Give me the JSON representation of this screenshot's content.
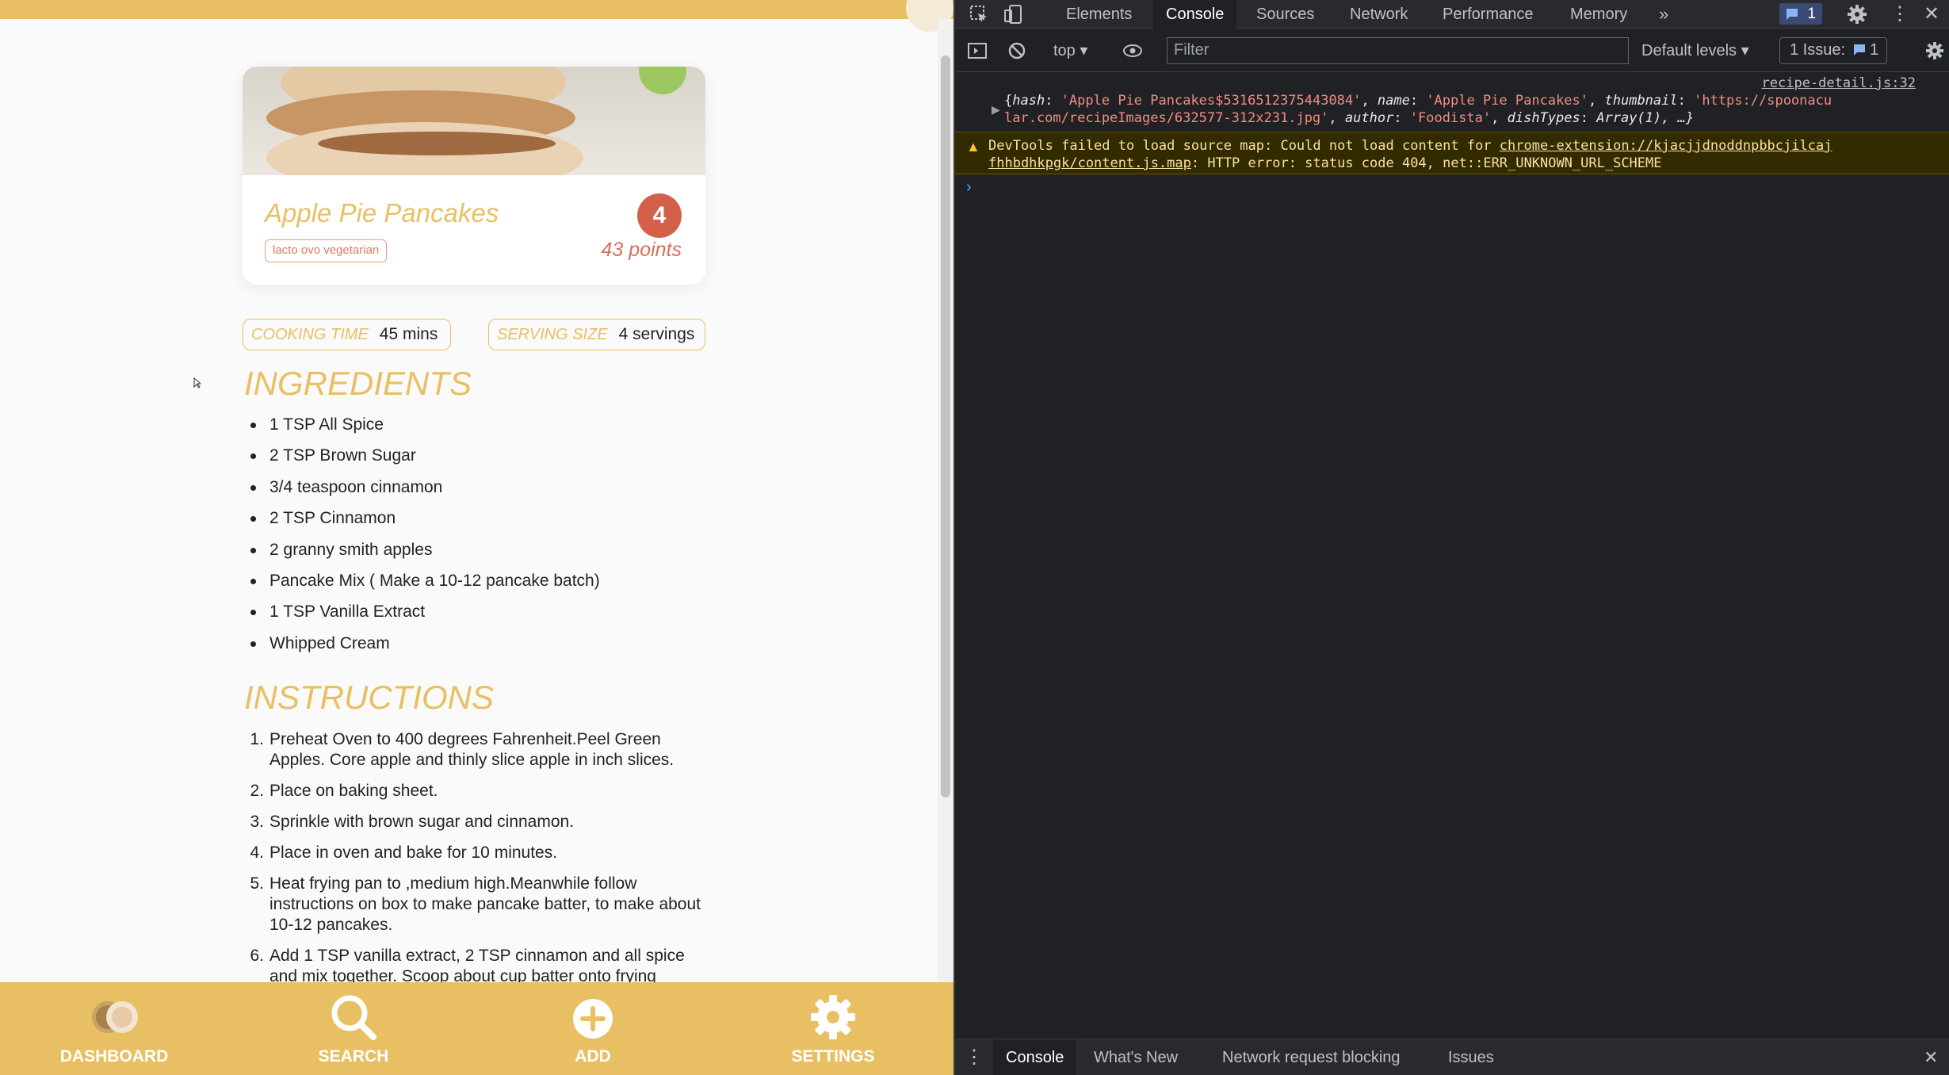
{
  "recipe": {
    "title": "Apple Pie Pancakes",
    "diet_tag": "lacto ovo vegetarian",
    "rank": "4",
    "points": "43 points",
    "cooking_time_label": "COOKING TIME",
    "cooking_time_value": "45 mins",
    "serving_size_label": "SERVING SIZE",
    "serving_size_value": "4 servings",
    "ingredients_heading": "INGREDIENTS",
    "ingredients": [
      "1 TSP All Spice",
      "2 TSP Brown Sugar",
      "3/4 teaspoon cinnamon",
      "2 TSP Cinnamon",
      "2 granny smith apples",
      "Pancake Mix ( Make a 10-12 pancake batch)",
      "1 TSP Vanilla Extract",
      "Whipped Cream"
    ],
    "instructions_heading": "INSTRUCTIONS",
    "instructions": [
      {
        "num": "1.",
        "text": "Preheat Oven to 400 degrees Fahrenheit.Peel Green Apples. Core apple and thinly slice apple in inch slices."
      },
      {
        "num": "2.",
        "text": "Place on baking sheet."
      },
      {
        "num": "3.",
        "text": "Sprinkle with brown sugar and cinnamon."
      },
      {
        "num": "4.",
        "text": "Place in oven and bake for 10 minutes."
      },
      {
        "num": "5.",
        "text": "Heat frying pan to ,medium high.Meanwhile follow instructions on box to make pancake batter, to make about 10-12 pancakes."
      },
      {
        "num": "6.",
        "text": "Add 1 TSP vanilla extract, 2 TSP cinnamon and all spice and mix together. Scoop about cup batter onto frying"
      }
    ]
  },
  "bottom_nav": {
    "dashboard": "DASHBOARD",
    "search": "SEARCH",
    "add": "ADD",
    "settings": "SETTINGS"
  },
  "devtools": {
    "tabs": [
      "Elements",
      "Console",
      "Sources",
      "Network",
      "Performance",
      "Memory"
    ],
    "active_tab": "Console",
    "message_badge": "1",
    "context": "top",
    "filter_placeholder": "Filter",
    "levels": "Default levels",
    "issues_label": "1 Issue:",
    "issues_count": "1",
    "log_source": "recipe-detail.js:32",
    "log_line1_prefix": "{",
    "log_hash_key": "hash",
    "log_hash_val": "'Apple Pie Pancakes$5316512375443084'",
    "log_name_key": "name",
    "log_name_val": "'Apple Pie Pancakes'",
    "log_thumb_key": "thumbnail",
    "log_thumb_val_1": "'https://spoonacu",
    "log_thumb_val_2": "lar.com/recipeImages/632577-312x231.jpg'",
    "log_author_key": "author",
    "log_author_val": "'Foodista'",
    "log_dish_key": "dishTypes",
    "log_dish_val": "Array(1), …}",
    "warn_prefix": "DevTools failed to load source map: Could not load content for ",
    "warn_link_1": "chrome-extension://kjacjjdnoddnpbbcjilcaj",
    "warn_link_2": "fhhbdhkpgk/content.js.map",
    "warn_suffix": ": HTTP error: status code 404, net::ERR_UNKNOWN_URL_SCHEME",
    "prompt": "›",
    "drawer_tabs": [
      "Console",
      "What's New",
      "Network request blocking",
      "Issues"
    ]
  },
  "colors": {
    "accent": "#e8c063",
    "badge": "#d5604a",
    "devtools_bg": "#202124"
  }
}
